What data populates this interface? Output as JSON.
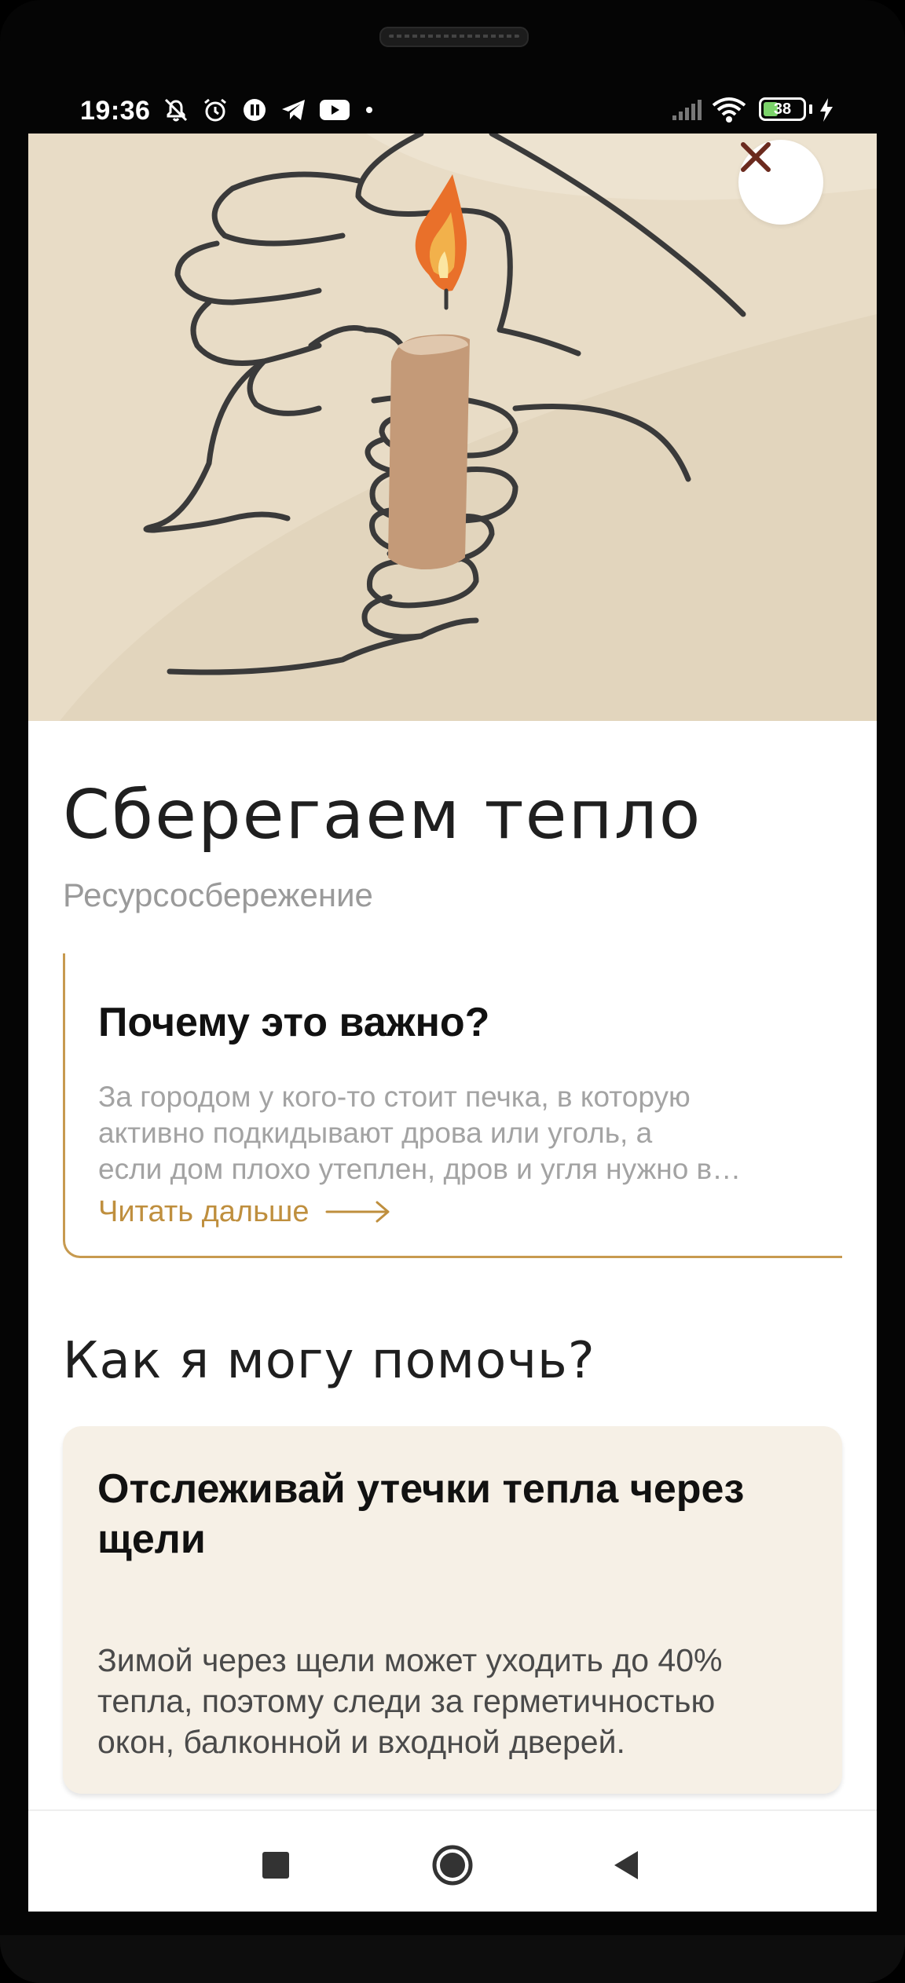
{
  "status_bar": {
    "time": "19:36",
    "battery": "38",
    "icons": [
      "mute-bell-icon",
      "alarm-icon",
      "pause-icon",
      "telegram-icon",
      "youtube-icon",
      "dot-icon",
      "signal-icon",
      "wifi-icon",
      "battery-icon",
      "charging-icon"
    ]
  },
  "close_label": "✕",
  "article": {
    "title": "Сберегаем тепло",
    "category": "Ресурсосбережение"
  },
  "why": {
    "title": "Почему это важно?",
    "text_lines": [
      "За городом у кого-то стоит печка, в которую",
      "активно подкидывают дрова или уголь, а",
      "если дом плохо утеплен, дров и угля нужно в…"
    ],
    "read_more": "Читать дальше"
  },
  "help": {
    "title": "Как я могу помочь?",
    "tip": {
      "title": "Отслеживай утечки тепла через щели",
      "text_lines": [
        "Зимой через щели может уходить до 40%",
        "тепла, поэтому следи за герметичностью",
        "окон, балконной и входной дверей."
      ]
    }
  },
  "navbar": {
    "buttons": [
      "recent-apps",
      "home",
      "back"
    ]
  },
  "colors": {
    "accent": "#c79a4f",
    "hero_bg": "#e8dcc6",
    "card_bg": "#f6f0e6",
    "candle": "#c49a78",
    "flame": "#e9702a"
  }
}
